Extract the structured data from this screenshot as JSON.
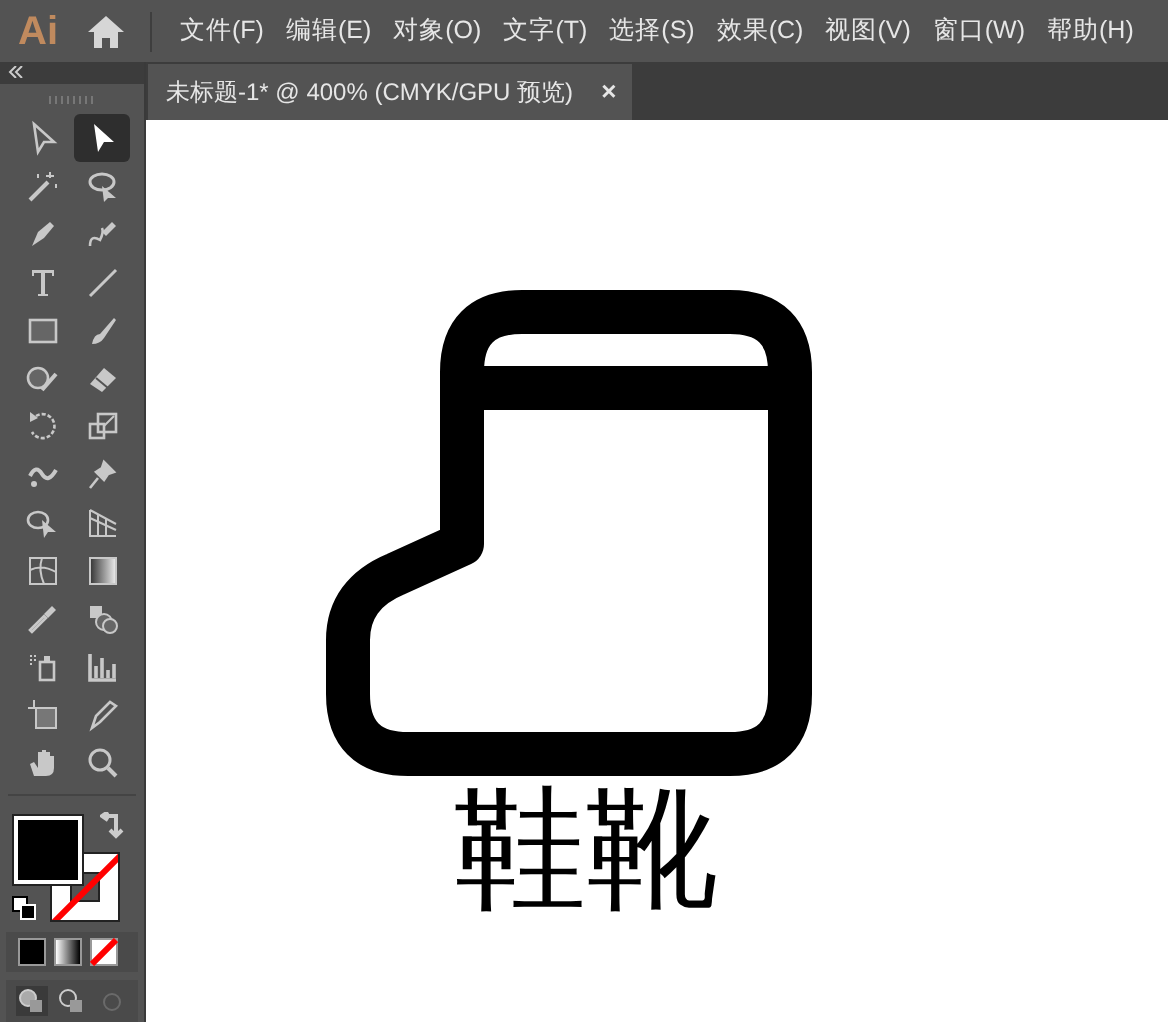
{
  "app": {
    "logo": "Ai"
  },
  "menu": [
    "文件(F)",
    "编辑(E)",
    "对象(O)",
    "文字(T)",
    "选择(S)",
    "效果(C)",
    "视图(V)",
    "窗口(W)",
    "帮助(H)"
  ],
  "document_tab": {
    "title": "未标题-1* @ 400% (CMYK/GPU 预览)",
    "close": "×"
  },
  "tools": [
    {
      "kind": "hollow-arrow",
      "selected": false
    },
    {
      "kind": "arrow",
      "selected": true
    },
    {
      "kind": "wand",
      "selected": false
    },
    {
      "kind": "lasso",
      "selected": false
    },
    {
      "kind": "pen",
      "selected": false
    },
    {
      "kind": "curve-pen",
      "selected": false
    },
    {
      "kind": "type",
      "selected": false
    },
    {
      "kind": "line",
      "selected": false
    },
    {
      "kind": "rectangle",
      "selected": false
    },
    {
      "kind": "brush",
      "selected": false
    },
    {
      "kind": "shaper",
      "selected": false
    },
    {
      "kind": "eraser",
      "selected": false
    },
    {
      "kind": "rotate",
      "selected": false
    },
    {
      "kind": "scale",
      "selected": false
    },
    {
      "kind": "warp",
      "selected": false
    },
    {
      "kind": "pin",
      "selected": false
    },
    {
      "kind": "shape-builder",
      "selected": false
    },
    {
      "kind": "perspective",
      "selected": false
    },
    {
      "kind": "mesh",
      "selected": false
    },
    {
      "kind": "gradient",
      "selected": false
    },
    {
      "kind": "eyedropper",
      "selected": false
    },
    {
      "kind": "blend",
      "selected": false
    },
    {
      "kind": "sprayer",
      "selected": false
    },
    {
      "kind": "graph",
      "selected": false
    },
    {
      "kind": "artboard",
      "selected": false
    },
    {
      "kind": "knife",
      "selected": false
    },
    {
      "kind": "hand",
      "selected": false
    },
    {
      "kind": "zoom",
      "selected": false
    }
  ],
  "canvas": {
    "caption": "鞋靴"
  }
}
